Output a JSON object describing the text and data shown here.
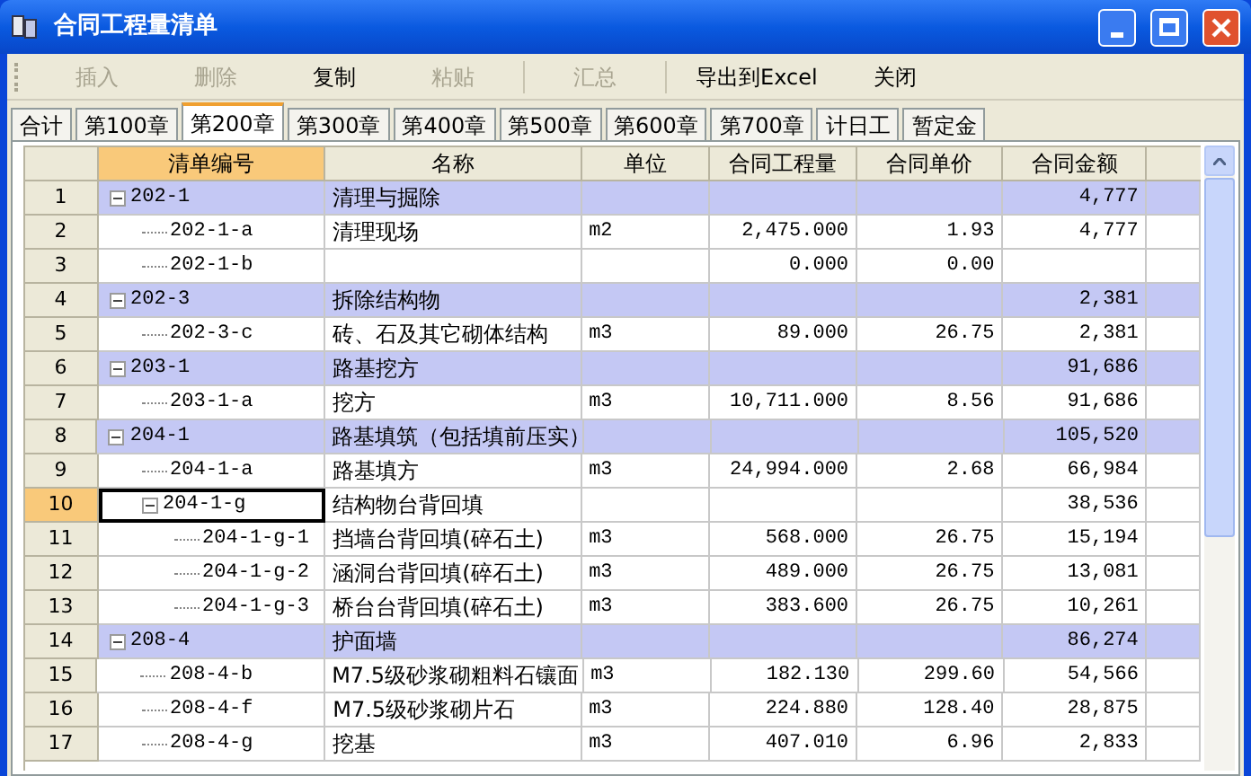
{
  "window": {
    "title": "合同工程量清单"
  },
  "toolbar": [
    {
      "kind": "button",
      "label": "插入",
      "disabled": true
    },
    {
      "kind": "button",
      "label": "删除",
      "disabled": true
    },
    {
      "kind": "button",
      "label": "复制",
      "disabled": false
    },
    {
      "kind": "button",
      "label": "粘贴",
      "disabled": true
    },
    {
      "kind": "separator"
    },
    {
      "kind": "button",
      "label": "汇总",
      "disabled": true
    },
    {
      "kind": "separator"
    },
    {
      "kind": "button",
      "label": "导出到Excel",
      "disabled": false
    },
    {
      "kind": "button",
      "label": "关闭",
      "disabled": false
    }
  ],
  "tabs": [
    {
      "label": "合计",
      "selected": false
    },
    {
      "label": "第100章",
      "selected": false
    },
    {
      "label": "第200章",
      "selected": true
    },
    {
      "label": "第300章",
      "selected": false
    },
    {
      "label": "第400章",
      "selected": false
    },
    {
      "label": "第500章",
      "selected": false
    },
    {
      "label": "第600章",
      "selected": false
    },
    {
      "label": "第700章",
      "selected": false
    },
    {
      "label": "计日工",
      "selected": false
    },
    {
      "label": "暂定金",
      "selected": false
    }
  ],
  "table": {
    "columns": [
      "清单编号",
      "名称",
      "单位",
      "合同工程量",
      "合同单价",
      "合同金额"
    ],
    "rows": [
      {
        "no": "1",
        "code": "202-1",
        "name": "清理与掘除",
        "amount": "4,777",
        "expanded": true,
        "selected": false,
        "children": [
          {
            "no": "2",
            "code": "202-1-a",
            "name": "清理现场",
            "unit": "m2",
            "qty": "2,475.000",
            "price": "1.93",
            "amount": "4,777",
            "selected": false
          },
          {
            "no": "3",
            "code": "202-1-b",
            "qty": "0.000",
            "price": "0.00",
            "selected": false
          }
        ]
      },
      {
        "no": "4",
        "code": "202-3",
        "name": "拆除结构物",
        "amount": "2,381",
        "expanded": true,
        "selected": false,
        "children": [
          {
            "no": "5",
            "code": "202-3-c",
            "name": "砖、石及其它砌体结构",
            "unit": "m3",
            "qty": "89.000",
            "price": "26.75",
            "amount": "2,381",
            "selected": false
          }
        ]
      },
      {
        "no": "6",
        "code": "203-1",
        "name": "路基挖方",
        "amount": "91,686",
        "expanded": true,
        "selected": false,
        "children": [
          {
            "no": "7",
            "code": "203-1-a",
            "name": "挖方",
            "unit": "m3",
            "qty": "10,711.000",
            "price": "8.56",
            "amount": "91,686",
            "selected": false
          }
        ]
      },
      {
        "no": "8",
        "code": "204-1",
        "name": "路基填筑（包括填前压实）",
        "amount": "105,520",
        "expanded": true,
        "selected": false,
        "children": [
          {
            "no": "9",
            "code": "204-1-a",
            "name": "路基填方",
            "unit": "m3",
            "qty": "24,994.000",
            "price": "2.68",
            "amount": "66,984",
            "selected": false
          },
          {
            "no": "10",
            "code": "204-1-g",
            "name": "结构物台背回填",
            "amount": "38,536",
            "expanded": true,
            "selected": true,
            "children": [
              {
                "no": "11",
                "code": "204-1-g-1",
                "name": "挡墙台背回填(碎石土)",
                "unit": "m3",
                "qty": "568.000",
                "price": "26.75",
                "amount": "15,194",
                "selected": false
              },
              {
                "no": "12",
                "code": "204-1-g-2",
                "name": "涵洞台背回填(碎石土)",
                "unit": "m3",
                "qty": "489.000",
                "price": "26.75",
                "amount": "13,081",
                "selected": false
              },
              {
                "no": "13",
                "code": "204-1-g-3",
                "name": "桥台台背回填(碎石土)",
                "unit": "m3",
                "qty": "383.600",
                "price": "26.75",
                "amount": "10,261",
                "selected": false
              }
            ]
          }
        ]
      },
      {
        "no": "14",
        "code": "208-4",
        "name": "护面墙",
        "amount": "86,274",
        "expanded": true,
        "selected": false,
        "children": [
          {
            "no": "15",
            "code": "208-4-b",
            "name": "M7.5级砂浆砌粗料石镶面",
            "unit": "m3",
            "qty": "182.130",
            "price": "299.60",
            "amount": "54,566",
            "selected": false
          },
          {
            "no": "16",
            "code": "208-4-f",
            "name": "M7.5级砂浆砌片石",
            "unit": "m3",
            "qty": "224.880",
            "price": "128.40",
            "amount": "28,875",
            "selected": false
          },
          {
            "no": "17",
            "code": "208-4-g",
            "name": "挖基",
            "unit": "m3",
            "qty": "407.010",
            "price": "6.96",
            "amount": "2,833",
            "selected": false
          }
        ]
      }
    ]
  }
}
